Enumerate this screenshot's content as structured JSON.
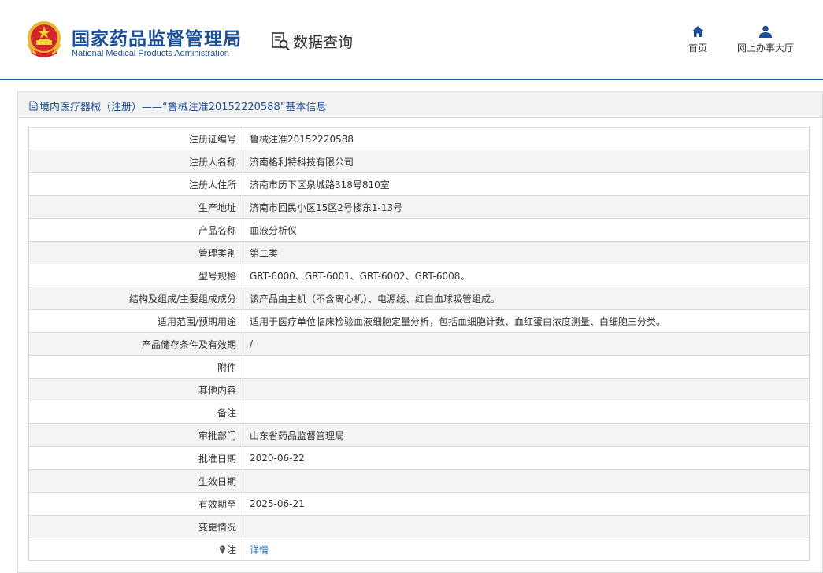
{
  "header": {
    "org_cn": "国家药品监督管理局",
    "org_en": "National Medical Products Administration",
    "query_label": "数据查询",
    "nav": [
      {
        "label": "首页",
        "icon": "home-icon"
      },
      {
        "label": "网上办事大厅",
        "icon": "user-icon"
      }
    ]
  },
  "panel": {
    "title": "境内医疗器械（注册）——“鲁械注准20152220588”基本信息"
  },
  "rows": [
    {
      "label": "注册证编号",
      "value": "鲁械注准20152220588"
    },
    {
      "label": "注册人名称",
      "value": "济南格利特科技有限公司"
    },
    {
      "label": "注册人住所",
      "value": "济南市历下区泉城路318号810室"
    },
    {
      "label": "生产地址",
      "value": "济南市回民小区15区2号楼东1-13号"
    },
    {
      "label": "产品名称",
      "value": "血液分析仪"
    },
    {
      "label": "管理类别",
      "value": "第二类"
    },
    {
      "label": "型号规格",
      "value": "GRT-6000、GRT-6001、GRT-6002、GRT-6008。"
    },
    {
      "label": "结构及组成/主要组成成分",
      "value": "该产品由主机（不含离心机）、电源线、红白血球吸管组成。"
    },
    {
      "label": "适用范围/预期用途",
      "value": "适用于医疗单位临床检验血液细胞定量分析，包括血细胞计数、血红蛋白浓度测量、白细胞三分类。"
    },
    {
      "label": "产品储存条件及有效期",
      "value": "/"
    },
    {
      "label": "附件",
      "value": ""
    },
    {
      "label": "其他内容",
      "value": ""
    },
    {
      "label": "备注",
      "value": ""
    },
    {
      "label": "审批部门",
      "value": "山东省药品监督管理局"
    },
    {
      "label": "批准日期",
      "value": "2020-06-22"
    },
    {
      "label": "生效日期",
      "value": ""
    },
    {
      "label": "有效期至",
      "value": "2025-06-21"
    },
    {
      "label": "变更情况",
      "value": ""
    }
  ],
  "note_row": {
    "label": "注",
    "link": "详情",
    "icon": "pin-icon"
  },
  "colors": {
    "brand": "#1b4f9c",
    "link": "#1b6fc2",
    "header_line": "#1a5ea8"
  }
}
